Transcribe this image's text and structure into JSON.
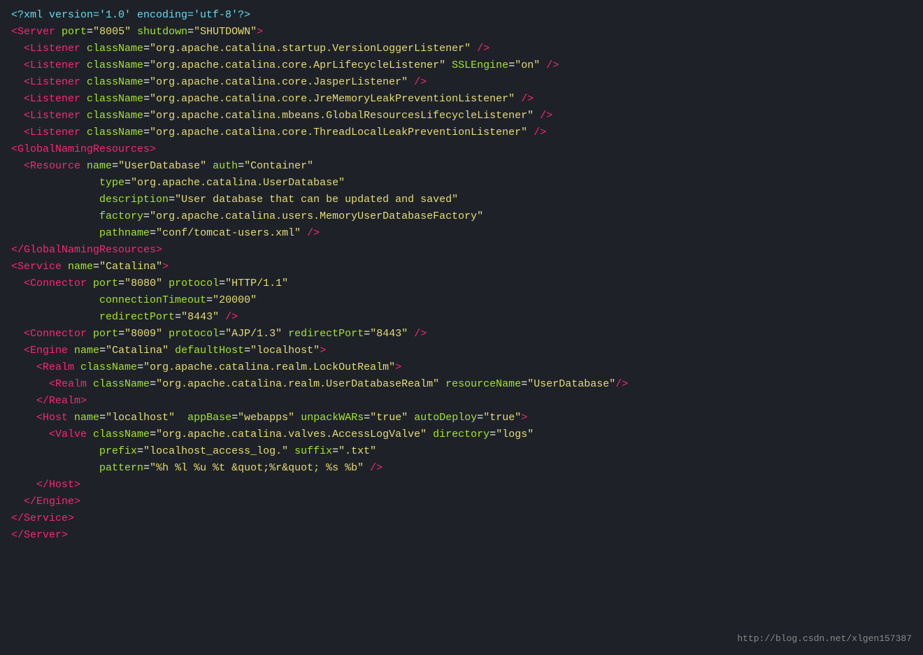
{
  "watermark": "http://blog.csdn.net/xlgen157387",
  "lines": [
    {
      "id": "l1",
      "tokens": [
        {
          "t": "prolog",
          "v": "<?xml version='1.0' encoding='utf-8'?>"
        }
      ]
    },
    {
      "id": "l2",
      "tokens": [
        {
          "t": "tag",
          "v": "<Server"
        },
        {
          "t": "text",
          "v": " "
        },
        {
          "t": "attr",
          "v": "port"
        },
        {
          "t": "text",
          "v": "="
        },
        {
          "t": "value",
          "v": "\"8005\""
        },
        {
          "t": "text",
          "v": " "
        },
        {
          "t": "attr",
          "v": "shutdown"
        },
        {
          "t": "text",
          "v": "="
        },
        {
          "t": "value",
          "v": "\"SHUTDOWN\""
        },
        {
          "t": "tag",
          "v": ">"
        }
      ]
    },
    {
      "id": "l3",
      "tokens": [
        {
          "t": "text",
          "v": "  "
        },
        {
          "t": "tag",
          "v": "<Listener"
        },
        {
          "t": "text",
          "v": " "
        },
        {
          "t": "attr",
          "v": "className"
        },
        {
          "t": "text",
          "v": "="
        },
        {
          "t": "value",
          "v": "\"org.apache.catalina.startup.VersionLoggerListener\""
        },
        {
          "t": "text",
          "v": " "
        },
        {
          "t": "tag",
          "v": "/>"
        }
      ]
    },
    {
      "id": "l4",
      "tokens": [
        {
          "t": "text",
          "v": "  "
        },
        {
          "t": "tag",
          "v": "<Listener"
        },
        {
          "t": "text",
          "v": " "
        },
        {
          "t": "attr",
          "v": "className"
        },
        {
          "t": "text",
          "v": "="
        },
        {
          "t": "value",
          "v": "\"org.apache.catalina.core.AprLifecycleListener\""
        },
        {
          "t": "text",
          "v": " "
        },
        {
          "t": "attr",
          "v": "SSLEngine"
        },
        {
          "t": "text",
          "v": "="
        },
        {
          "t": "value",
          "v": "\"on\""
        },
        {
          "t": "text",
          "v": " "
        },
        {
          "t": "tag",
          "v": "/>"
        }
      ]
    },
    {
      "id": "l5",
      "tokens": [
        {
          "t": "text",
          "v": "  "
        },
        {
          "t": "tag",
          "v": "<Listener"
        },
        {
          "t": "text",
          "v": " "
        },
        {
          "t": "attr",
          "v": "className"
        },
        {
          "t": "text",
          "v": "="
        },
        {
          "t": "value",
          "v": "\"org.apache.catalina.core.JasperListener\""
        },
        {
          "t": "text",
          "v": " "
        },
        {
          "t": "tag",
          "v": "/>"
        }
      ]
    },
    {
      "id": "l6",
      "tokens": [
        {
          "t": "text",
          "v": "  "
        },
        {
          "t": "tag",
          "v": "<Listener"
        },
        {
          "t": "text",
          "v": " "
        },
        {
          "t": "attr",
          "v": "className"
        },
        {
          "t": "text",
          "v": "="
        },
        {
          "t": "value",
          "v": "\"org.apache.catalina.core.JreMemoryLeakPreventionListener\""
        },
        {
          "t": "text",
          "v": " "
        },
        {
          "t": "tag",
          "v": "/>"
        }
      ]
    },
    {
      "id": "l7",
      "tokens": [
        {
          "t": "text",
          "v": "  "
        },
        {
          "t": "tag",
          "v": "<Listener"
        },
        {
          "t": "text",
          "v": " "
        },
        {
          "t": "attr",
          "v": "className"
        },
        {
          "t": "text",
          "v": "="
        },
        {
          "t": "value",
          "v": "\"org.apache.catalina.mbeans.GlobalResourcesLifecycleListener\""
        },
        {
          "t": "text",
          "v": " "
        },
        {
          "t": "tag",
          "v": "/>"
        }
      ]
    },
    {
      "id": "l8",
      "tokens": [
        {
          "t": "text",
          "v": "  "
        },
        {
          "t": "tag",
          "v": "<Listener"
        },
        {
          "t": "text",
          "v": " "
        },
        {
          "t": "attr",
          "v": "className"
        },
        {
          "t": "text",
          "v": "="
        },
        {
          "t": "value",
          "v": "\"org.apache.catalina.core.ThreadLocalLeakPreventionListener\""
        },
        {
          "t": "text",
          "v": " "
        },
        {
          "t": "tag",
          "v": "/>"
        }
      ]
    },
    {
      "id": "l9",
      "tokens": [
        {
          "t": "text",
          "v": ""
        }
      ]
    },
    {
      "id": "l10",
      "tokens": [
        {
          "t": "tag",
          "v": "<GlobalNamingResources"
        }
      ],
      "suffix": [
        {
          "t": "tag",
          "v": ">"
        }
      ]
    },
    {
      "id": "l11",
      "tokens": [
        {
          "t": "text",
          "v": "  "
        },
        {
          "t": "tag",
          "v": "<Resource"
        },
        {
          "t": "text",
          "v": " "
        },
        {
          "t": "attr",
          "v": "name"
        },
        {
          "t": "text",
          "v": "="
        },
        {
          "t": "value",
          "v": "\"UserDatabase\""
        },
        {
          "t": "text",
          "v": " "
        },
        {
          "t": "attr",
          "v": "auth"
        },
        {
          "t": "text",
          "v": "="
        },
        {
          "t": "value",
          "v": "\"Container\""
        }
      ]
    },
    {
      "id": "l12",
      "tokens": [
        {
          "t": "text",
          "v": "              "
        },
        {
          "t": "attr",
          "v": "type"
        },
        {
          "t": "text",
          "v": "="
        },
        {
          "t": "value",
          "v": "\"org.apache.catalina.UserDatabase\""
        }
      ]
    },
    {
      "id": "l13",
      "tokens": [
        {
          "t": "text",
          "v": "              "
        },
        {
          "t": "attr",
          "v": "description"
        },
        {
          "t": "text",
          "v": "="
        },
        {
          "t": "value",
          "v": "\"User database that can be updated and saved\""
        }
      ]
    },
    {
      "id": "l14",
      "tokens": [
        {
          "t": "text",
          "v": "              "
        },
        {
          "t": "attr",
          "v": "factory"
        },
        {
          "t": "text",
          "v": "="
        },
        {
          "t": "value",
          "v": "\"org.apache.catalina.users.MemoryUserDatabaseFactory\""
        }
      ]
    },
    {
      "id": "l15",
      "tokens": [
        {
          "t": "text",
          "v": "              "
        },
        {
          "t": "attr",
          "v": "pathname"
        },
        {
          "t": "text",
          "v": "="
        },
        {
          "t": "value",
          "v": "\"conf/tomcat-users.xml\""
        },
        {
          "t": "text",
          "v": " "
        },
        {
          "t": "tag",
          "v": "/>"
        }
      ]
    },
    {
      "id": "l16",
      "tokens": [
        {
          "t": "tag",
          "v": "</GlobalNamingResources"
        }
      ],
      "suffix": [
        {
          "t": "tag",
          "v": ">"
        }
      ]
    },
    {
      "id": "l17",
      "tokens": [
        {
          "t": "text",
          "v": ""
        }
      ]
    },
    {
      "id": "l18",
      "tokens": [
        {
          "t": "tag",
          "v": "<Service"
        },
        {
          "t": "text",
          "v": " "
        },
        {
          "t": "attr",
          "v": "name"
        },
        {
          "t": "text",
          "v": "="
        },
        {
          "t": "value",
          "v": "\"Catalina\""
        },
        {
          "t": "tag",
          "v": ">"
        }
      ]
    },
    {
      "id": "l19",
      "tokens": [
        {
          "t": "text",
          "v": "  "
        },
        {
          "t": "tag",
          "v": "<Connector"
        },
        {
          "t": "text",
          "v": " "
        },
        {
          "t": "attr",
          "v": "port"
        },
        {
          "t": "text",
          "v": "="
        },
        {
          "t": "value",
          "v": "\"8080\""
        },
        {
          "t": "text",
          "v": " "
        },
        {
          "t": "attr",
          "v": "protocol"
        },
        {
          "t": "text",
          "v": "="
        },
        {
          "t": "value",
          "v": "\"HTTP/1.1\""
        }
      ]
    },
    {
      "id": "l20",
      "tokens": [
        {
          "t": "text",
          "v": "              "
        },
        {
          "t": "attr",
          "v": "connectionTimeout"
        },
        {
          "t": "text",
          "v": "="
        },
        {
          "t": "value",
          "v": "\"20000\""
        }
      ]
    },
    {
      "id": "l21",
      "tokens": [
        {
          "t": "text",
          "v": "              "
        },
        {
          "t": "attr",
          "v": "redirectPort"
        },
        {
          "t": "text",
          "v": "="
        },
        {
          "t": "value",
          "v": "\"8443\""
        },
        {
          "t": "text",
          "v": " "
        },
        {
          "t": "tag",
          "v": "/>"
        }
      ]
    },
    {
      "id": "l22",
      "tokens": [
        {
          "t": "text",
          "v": "  "
        },
        {
          "t": "tag",
          "v": "<Connector"
        },
        {
          "t": "text",
          "v": " "
        },
        {
          "t": "attr",
          "v": "port"
        },
        {
          "t": "text",
          "v": "="
        },
        {
          "t": "value",
          "v": "\"8009\""
        },
        {
          "t": "text",
          "v": " "
        },
        {
          "t": "attr",
          "v": "protocol"
        },
        {
          "t": "text",
          "v": "="
        },
        {
          "t": "value",
          "v": "\"AJP/1.3\""
        },
        {
          "t": "text",
          "v": " "
        },
        {
          "t": "attr",
          "v": "redirectPort"
        },
        {
          "t": "text",
          "v": "="
        },
        {
          "t": "value",
          "v": "\"8443\""
        },
        {
          "t": "text",
          "v": " "
        },
        {
          "t": "tag",
          "v": "/>"
        }
      ]
    },
    {
      "id": "l23",
      "tokens": [
        {
          "t": "text",
          "v": "  "
        },
        {
          "t": "tag",
          "v": "<Engine"
        },
        {
          "t": "text",
          "v": " "
        },
        {
          "t": "attr",
          "v": "name"
        },
        {
          "t": "text",
          "v": "="
        },
        {
          "t": "value",
          "v": "\"Catalina\""
        },
        {
          "t": "text",
          "v": " "
        },
        {
          "t": "attr",
          "v": "defaultHost"
        },
        {
          "t": "text",
          "v": "="
        },
        {
          "t": "value",
          "v": "\"localhost\""
        },
        {
          "t": "tag",
          "v": ">"
        }
      ]
    },
    {
      "id": "l24",
      "tokens": [
        {
          "t": "text",
          "v": "    "
        },
        {
          "t": "tag",
          "v": "<Realm"
        },
        {
          "t": "text",
          "v": " "
        },
        {
          "t": "attr",
          "v": "className"
        },
        {
          "t": "text",
          "v": "="
        },
        {
          "t": "value",
          "v": "\"org.apache.catalina.realm.LockOutRealm\""
        },
        {
          "t": "tag",
          "v": ">"
        }
      ]
    },
    {
      "id": "l25",
      "tokens": [
        {
          "t": "text",
          "v": "      "
        },
        {
          "t": "tag",
          "v": "<Realm"
        },
        {
          "t": "text",
          "v": " "
        },
        {
          "t": "attr",
          "v": "className"
        },
        {
          "t": "text",
          "v": "="
        },
        {
          "t": "value",
          "v": "\"org.apache.catalina.realm.UserDatabaseRealm\""
        },
        {
          "t": "text",
          "v": " "
        },
        {
          "t": "attr",
          "v": "resourceName"
        },
        {
          "t": "text",
          "v": "="
        },
        {
          "t": "value",
          "v": "\"UserDatabase\""
        },
        {
          "t": "tag",
          "v": "/>"
        }
      ]
    },
    {
      "id": "l26",
      "tokens": [
        {
          "t": "text",
          "v": "    "
        },
        {
          "t": "tag",
          "v": "</Realm"
        }
      ],
      "suffix": [
        {
          "t": "tag",
          "v": ">"
        }
      ]
    },
    {
      "id": "l27",
      "tokens": [
        {
          "t": "text",
          "v": "    "
        },
        {
          "t": "tag",
          "v": "<Host"
        },
        {
          "t": "text",
          "v": " "
        },
        {
          "t": "attr",
          "v": "name"
        },
        {
          "t": "text",
          "v": "="
        },
        {
          "t": "value",
          "v": "\"localhost\""
        },
        {
          "t": "text",
          "v": "  "
        },
        {
          "t": "attr",
          "v": "appBase"
        },
        {
          "t": "text",
          "v": "="
        },
        {
          "t": "value",
          "v": "\"webapps\""
        },
        {
          "t": "text",
          "v": " "
        },
        {
          "t": "attr",
          "v": "unpackWARs"
        },
        {
          "t": "text",
          "v": "="
        },
        {
          "t": "value",
          "v": "\"true\""
        },
        {
          "t": "text",
          "v": " "
        },
        {
          "t": "attr",
          "v": "autoDeploy"
        },
        {
          "t": "text",
          "v": "="
        },
        {
          "t": "value",
          "v": "\"true\""
        },
        {
          "t": "tag",
          "v": ">"
        }
      ]
    },
    {
      "id": "l28",
      "tokens": [
        {
          "t": "text",
          "v": "      "
        },
        {
          "t": "tag",
          "v": "<Valve"
        },
        {
          "t": "text",
          "v": " "
        },
        {
          "t": "attr",
          "v": "className"
        },
        {
          "t": "text",
          "v": "="
        },
        {
          "t": "value",
          "v": "\"org.apache.catalina.valves.AccessLogValve\""
        },
        {
          "t": "text",
          "v": " "
        },
        {
          "t": "attr",
          "v": "directory"
        },
        {
          "t": "text",
          "v": "="
        },
        {
          "t": "value",
          "v": "\"logs\""
        }
      ]
    },
    {
      "id": "l29",
      "tokens": [
        {
          "t": "text",
          "v": "              "
        },
        {
          "t": "attr",
          "v": "prefix"
        },
        {
          "t": "text",
          "v": "="
        },
        {
          "t": "value",
          "v": "\"localhost_access_log.\""
        },
        {
          "t": "text",
          "v": " "
        },
        {
          "t": "attr",
          "v": "suffix"
        },
        {
          "t": "text",
          "v": "="
        },
        {
          "t": "value",
          "v": "\".txt\""
        }
      ]
    },
    {
      "id": "l30",
      "tokens": [
        {
          "t": "text",
          "v": "              "
        },
        {
          "t": "attr",
          "v": "pattern"
        },
        {
          "t": "text",
          "v": "="
        },
        {
          "t": "value",
          "v": "\"%h %l %u %t &quot;%r&quot; %s %b\""
        },
        {
          "t": "text",
          "v": " "
        },
        {
          "t": "tag",
          "v": "/>"
        }
      ]
    },
    {
      "id": "l31",
      "tokens": [
        {
          "t": "text",
          "v": "    "
        },
        {
          "t": "tag",
          "v": "</Host"
        }
      ],
      "suffix": [
        {
          "t": "tag",
          "v": ">"
        }
      ]
    },
    {
      "id": "l32",
      "tokens": [
        {
          "t": "text",
          "v": "  "
        },
        {
          "t": "tag",
          "v": "</Engine"
        }
      ],
      "suffix": [
        {
          "t": "tag",
          "v": ">"
        }
      ]
    },
    {
      "id": "l33",
      "tokens": [
        {
          "t": "tag",
          "v": "</Service"
        }
      ],
      "suffix": [
        {
          "t": "tag",
          "v": ">"
        }
      ]
    },
    {
      "id": "l34",
      "tokens": [
        {
          "t": "tag",
          "v": "</Server"
        }
      ],
      "suffix": [
        {
          "t": "tag",
          "v": ">"
        }
      ]
    }
  ]
}
